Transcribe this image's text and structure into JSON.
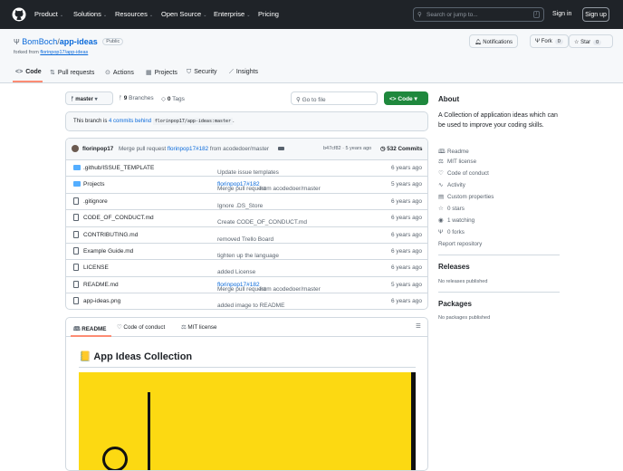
{
  "header": {
    "nav": [
      "Product",
      "Solutions",
      "Resources",
      "Open Source",
      "Enterprise",
      "Pricing"
    ],
    "search_placeholder": "Search or jump to...",
    "search_key": "/",
    "sign_in": "Sign in",
    "sign_up": "Sign up"
  },
  "repo": {
    "owner": "BomBoch",
    "sep": "/",
    "name": "app-ideas",
    "visibility": "Public",
    "forked_prefix": "forked from",
    "forked_from": "florinpop17/app-ideas",
    "notifications": "Notifications",
    "fork": "Fork",
    "fork_count": "0",
    "star": "Star",
    "star_count": "0"
  },
  "tabs": [
    "Code",
    "Pull requests",
    "Actions",
    "Projects",
    "Security",
    "Insights"
  ],
  "toolbar": {
    "branch": "master",
    "branches_count": "9",
    "branches": "Branches",
    "tags_count": "0",
    "tags": "Tags",
    "go_to_file": "Go to file",
    "code": "Code"
  },
  "banner": {
    "prefix": "This branch is",
    "link": "4 commits behind",
    "ref": "florinpop17/app-ideas:master",
    "suffix": "."
  },
  "commit": {
    "author": "florinpop17",
    "msg_prefix": "Merge pull request",
    "pr": "florinpop17#182",
    "msg_suffix": "from acodedoer/master",
    "sha_time": "b47cf82 · 5 years ago",
    "commits": "532 Commits"
  },
  "files": [
    {
      "type": "dir",
      "name": ".github/ISSUE_TEMPLATE",
      "msg": "Update issue templates",
      "time": "6 years ago"
    },
    {
      "type": "dir",
      "name": "Projects",
      "msg": "Merge pull request",
      "pr": "florinpop17#182",
      "msg2": "from acodedoer/master",
      "time": "5 years ago"
    },
    {
      "type": "file",
      "name": ".gitignore",
      "msg": "Ignore .DS_Store",
      "time": "6 years ago"
    },
    {
      "type": "file",
      "name": "CODE_OF_CONDUCT.md",
      "msg": "Create CODE_OF_CONDUCT.md",
      "time": "6 years ago"
    },
    {
      "type": "file",
      "name": "CONTRIBUTING.md",
      "msg": "removed Trello Board",
      "time": "6 years ago"
    },
    {
      "type": "file",
      "name": "Example Guide.md",
      "msg": "tighten up the language",
      "time": "6 years ago"
    },
    {
      "type": "file",
      "name": "LICENSE",
      "msg": "added License",
      "time": "6 years ago"
    },
    {
      "type": "file",
      "name": "README.md",
      "msg": "Merge pull request",
      "pr": "florinpop17#182",
      "msg2": "from acodedoer/master",
      "time": "5 years ago"
    },
    {
      "type": "file",
      "name": "app-ideas.png",
      "msg": "added image to README",
      "time": "6 years ago"
    }
  ],
  "readme": {
    "tabs": [
      "README",
      "Code of conduct",
      "MIT license"
    ],
    "title": "App Ideas Collection",
    "emoji": "📒",
    "banner_color": "#fcd912"
  },
  "about": {
    "title": "About",
    "description": "A Collection of application ideas which can be used to improve your coding skills.",
    "items": [
      "Readme",
      "MIT license",
      "Code of conduct",
      "Activity",
      "Custom properties",
      "0 stars",
      "1 watching",
      "0 forks"
    ],
    "report": "Report repository"
  },
  "releases": {
    "title": "Releases",
    "text": "No releases published"
  },
  "packages": {
    "title": "Packages",
    "text": "No packages published"
  }
}
